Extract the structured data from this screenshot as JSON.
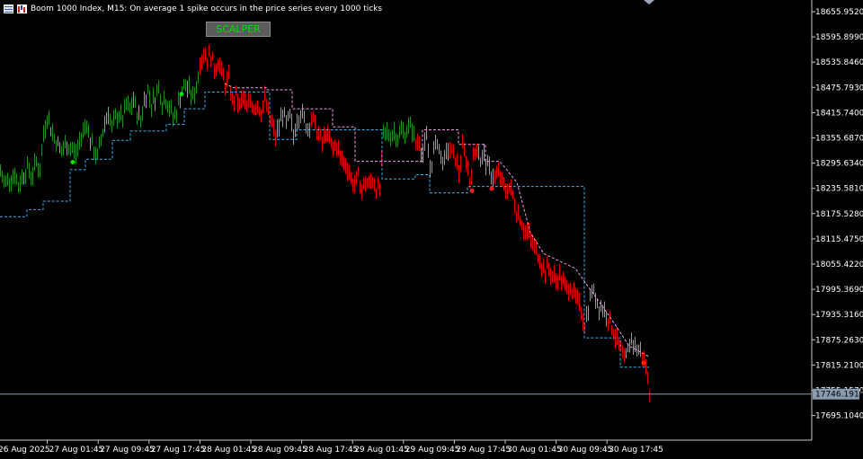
{
  "header": {
    "symbol_text": "Boom 1000 Index, M15:  On average 1 spike occurs in the price series every 1000 ticks",
    "button_label": "SCALPER"
  },
  "colors": {
    "background": "#000000",
    "axis": "#c8c8c8",
    "bull": "#1f8f1f",
    "bear": "#e00000",
    "neutral": "#9a9a9a",
    "support_line": "#3fb0e8",
    "resistance_line": "#f0a0e8",
    "current_price_line": "#8a9bb0",
    "signal_buy": "#00e000",
    "signal_sell": "#ff2020"
  },
  "chart_data": {
    "type": "line",
    "y_tick_labels": [
      "18655.9520",
      "18595.8990",
      "18535.8460",
      "18475.7930",
      "18415.7400",
      "18355.6870",
      "18295.6340",
      "18235.5810",
      "18175.5280",
      "18115.4750",
      "18055.4220",
      "17995.3690",
      "17935.3160",
      "17875.2630",
      "17815.2100",
      "17755.1570",
      "17695.1040"
    ],
    "ylim": [
      17664,
      18676
    ],
    "current_price": 17746.191,
    "current_price_label": "17746.1910",
    "x_tick_labels": [
      "26 Aug 2025",
      "27 Aug 01:45",
      "27 Aug 09:45",
      "27 Aug 17:45",
      "28 Aug 01:45",
      "28 Aug 09:45",
      "28 Aug 17:45",
      "29 Aug 01:45",
      "29 Aug 09:45",
      "29 Aug 17:45",
      "30 Aug 01:45",
      "30 Aug 09:45",
      "30 Aug 17:45"
    ],
    "price_path": [
      [
        0,
        18275
      ],
      [
        4,
        18248
      ],
      [
        8,
        18255
      ],
      [
        12,
        18262
      ],
      [
        16,
        18270
      ],
      [
        20,
        18240
      ],
      [
        25,
        18268
      ],
      [
        30,
        18285
      ],
      [
        35,
        18265
      ],
      [
        40,
        18300
      ],
      [
        44,
        18278
      ],
      [
        48,
        18365
      ],
      [
        52,
        18410
      ],
      [
        56,
        18380
      ],
      [
        60,
        18355
      ],
      [
        64,
        18340
      ],
      [
        68,
        18322
      ],
      [
        72,
        18338
      ],
      [
        76,
        18335
      ],
      [
        80,
        18330
      ],
      [
        84,
        18318
      ],
      [
        88,
        18345
      ],
      [
        92,
        18372
      ],
      [
        96,
        18395
      ],
      [
        100,
        18348
      ],
      [
        104,
        18325
      ],
      [
        108,
        18310
      ],
      [
        112,
        18352
      ],
      [
        116,
        18392
      ],
      [
        120,
        18420
      ],
      [
        124,
        18375
      ],
      [
        128,
        18402
      ],
      [
        132,
        18412
      ],
      [
        136,
        18398
      ],
      [
        140,
        18432
      ],
      [
        144,
        18422
      ],
      [
        148,
        18445
      ],
      [
        152,
        18415
      ],
      [
        156,
        18398
      ],
      [
        160,
        18445
      ],
      [
        164,
        18468
      ],
      [
        168,
        18436
      ],
      [
        172,
        18452
      ],
      [
        176,
        18478
      ],
      [
        180,
        18440
      ],
      [
        184,
        18448
      ],
      [
        188,
        18428
      ],
      [
        192,
        18405
      ],
      [
        196,
        18418
      ],
      [
        200,
        18458
      ],
      [
        205,
        18480
      ],
      [
        210,
        18470
      ],
      [
        214,
        18452
      ],
      [
        218,
        18476
      ],
      [
        222,
        18538
      ],
      [
        226,
        18558
      ],
      [
        230,
        18545
      ],
      [
        234,
        18552
      ],
      [
        238,
        18522
      ],
      [
        242,
        18538
      ],
      [
        246,
        18512
      ],
      [
        250,
        18484
      ],
      [
        254,
        18495
      ],
      [
        258,
        18440
      ],
      [
        262,
        18458
      ],
      [
        266,
        18430
      ],
      [
        270,
        18452
      ],
      [
        274,
        18422
      ],
      [
        278,
        18444
      ],
      [
        282,
        18430
      ],
      [
        286,
        18438
      ],
      [
        290,
        18418
      ],
      [
        294,
        18448
      ],
      [
        298,
        18412
      ],
      [
        302,
        18388
      ],
      [
        306,
        18358
      ],
      [
        310,
        18382
      ],
      [
        314,
        18416
      ],
      [
        318,
        18388
      ],
      [
        322,
        18405
      ],
      [
        326,
        18360
      ],
      [
        330,
        18402
      ],
      [
        334,
        18418
      ],
      [
        338,
        18398
      ],
      [
        342,
        18380
      ],
      [
        346,
        18405
      ],
      [
        350,
        18385
      ],
      [
        354,
        18362
      ],
      [
        358,
        18342
      ],
      [
        362,
        18368
      ],
      [
        366,
        18348
      ],
      [
        370,
        18330
      ],
      [
        374,
        18340
      ],
      [
        378,
        18310
      ],
      [
        382,
        18298
      ],
      [
        386,
        18288
      ],
      [
        390,
        18258
      ],
      [
        394,
        18245
      ],
      [
        398,
        18262
      ],
      [
        402,
        18232
      ],
      [
        406,
        18252
      ],
      [
        410,
        18242
      ],
      [
        414,
        18258
      ],
      [
        418,
        18236
      ],
      [
        422,
        18230
      ],
      [
        426,
        18364
      ],
      [
        430,
        18368
      ],
      [
        434,
        18360
      ],
      [
        438,
        18372
      ],
      [
        442,
        18358
      ],
      [
        446,
        18370
      ],
      [
        450,
        18366
      ],
      [
        454,
        18382
      ],
      [
        458,
        18378
      ],
      [
        462,
        18342
      ],
      [
        466,
        18350
      ],
      [
        470,
        18315
      ],
      [
        474,
        18355
      ],
      [
        478,
        18282
      ],
      [
        482,
        18322
      ],
      [
        486,
        18352
      ],
      [
        490,
        18310
      ],
      [
        494,
        18298
      ],
      [
        498,
        18332
      ],
      [
        502,
        18318
      ],
      [
        506,
        18310
      ],
      [
        510,
        18272
      ],
      [
        514,
        18330
      ],
      [
        518,
        18305
      ],
      [
        522,
        18255
      ],
      [
        526,
        18302
      ],
      [
        530,
        18342
      ],
      [
        534,
        18302
      ],
      [
        538,
        18315
      ],
      [
        542,
        18285
      ],
      [
        546,
        18272
      ],
      [
        550,
        18262
      ],
      [
        554,
        18268
      ],
      [
        558,
        18250
      ],
      [
        562,
        18230
      ],
      [
        566,
        18238
      ],
      [
        570,
        18220
      ],
      [
        574,
        18180
      ],
      [
        578,
        18168
      ],
      [
        582,
        18140
      ],
      [
        586,
        18130
      ],
      [
        590,
        18112
      ],
      [
        594,
        18095
      ],
      [
        598,
        18082
      ],
      [
        602,
        18055
      ],
      [
        606,
        18040
      ],
      [
        610,
        18045
      ],
      [
        614,
        18028
      ],
      [
        618,
        18015
      ],
      [
        622,
        18030
      ],
      [
        626,
        18008
      ],
      [
        630,
        17998
      ],
      [
        634,
        18005
      ],
      [
        638,
        17980
      ],
      [
        642,
        17965
      ],
      [
        646,
        17944
      ],
      [
        650,
        17912
      ],
      [
        654,
        17948
      ],
      [
        658,
        17995
      ],
      [
        662,
        17975
      ],
      [
        666,
        17958
      ],
      [
        670,
        17950
      ],
      [
        674,
        17938
      ],
      [
        678,
        17918
      ],
      [
        682,
        17898
      ],
      [
        686,
        17872
      ],
      [
        690,
        17852
      ],
      [
        694,
        17820
      ],
      [
        698,
        17848
      ],
      [
        702,
        17878
      ],
      [
        706,
        17860
      ],
      [
        710,
        17850
      ],
      [
        714,
        17842
      ],
      [
        718,
        17810
      ],
      [
        722,
        17748
      ]
    ],
    "support_steps": [
      [
        0,
        18168
      ],
      [
        30,
        18168
      ],
      [
        30,
        18185
      ],
      [
        48,
        18185
      ],
      [
        48,
        18205
      ],
      [
        78,
        18205
      ],
      [
        78,
        18280
      ],
      [
        95,
        18280
      ],
      [
        95,
        18305
      ],
      [
        125,
        18305
      ],
      [
        125,
        18350
      ],
      [
        145,
        18350
      ],
      [
        145,
        18372
      ],
      [
        185,
        18372
      ],
      [
        185,
        18388
      ],
      [
        205,
        18388
      ],
      [
        205,
        18425
      ],
      [
        228,
        18425
      ],
      [
        228,
        18465
      ],
      [
        252,
        18465
      ],
      [
        252,
        18465
      ],
      [
        300,
        18465
      ],
      [
        300,
        18352
      ],
      [
        330,
        18352
      ],
      [
        330,
        18375
      ],
      [
        375,
        18375
      ],
      [
        375,
        18375
      ],
      [
        425,
        18375
      ],
      [
        425,
        18258
      ],
      [
        462,
        18258
      ],
      [
        462,
        18268
      ],
      [
        478,
        18268
      ],
      [
        478,
        18225
      ],
      [
        520,
        18225
      ],
      [
        520,
        18240
      ],
      [
        555,
        18240
      ],
      [
        555,
        18240
      ],
      [
        650,
        18240
      ],
      [
        650,
        17880
      ],
      [
        690,
        17880
      ],
      [
        690,
        17810
      ],
      [
        722,
        17810
      ]
    ],
    "resistance_steps": [
      [
        250,
        18485
      ],
      [
        260,
        18475
      ],
      [
        296,
        18475
      ],
      [
        296,
        18470
      ],
      [
        325,
        18470
      ],
      [
        325,
        18425
      ],
      [
        370,
        18425
      ],
      [
        370,
        18382
      ],
      [
        395,
        18382
      ],
      [
        395,
        18300
      ],
      [
        425,
        18300
      ],
      [
        425,
        18300
      ],
      [
        470,
        18300
      ],
      [
        470,
        18375
      ],
      [
        510,
        18375
      ],
      [
        510,
        18340
      ],
      [
        540,
        18340
      ],
      [
        540,
        18300
      ],
      [
        556,
        18300
      ],
      [
        556,
        18300
      ],
      [
        575,
        18250
      ],
      [
        590,
        18130
      ],
      [
        605,
        18080
      ],
      [
        640,
        18045
      ],
      [
        660,
        17985
      ],
      [
        680,
        17925
      ],
      [
        700,
        17860
      ],
      [
        722,
        17835
      ]
    ],
    "signals": [
      {
        "x": 81,
        "y": 18298,
        "kind": "buy"
      },
      {
        "x": 202,
        "y": 18460,
        "kind": "buy"
      },
      {
        "x": 525,
        "y": 18230,
        "kind": "sell"
      },
      {
        "x": 547,
        "y": 18235,
        "kind": "sell"
      },
      {
        "x": 716,
        "y": 17820,
        "kind": "sell"
      }
    ]
  }
}
